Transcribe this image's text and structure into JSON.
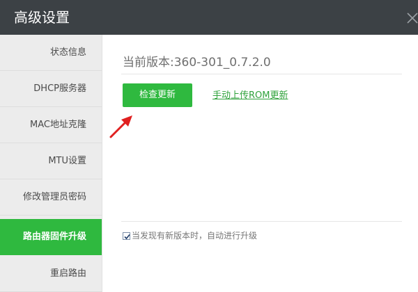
{
  "window": {
    "title": "高级设置",
    "close_icon": "close-icon"
  },
  "colors": {
    "titlebar": "#3c4145",
    "sidebar": "#ececec",
    "accent": "#2fb93f",
    "arrow": "#e02020"
  },
  "sidebar": {
    "items": [
      {
        "label": "状态信息",
        "active": false
      },
      {
        "label": "DHCP服务器",
        "active": false
      },
      {
        "label": "MAC地址克隆",
        "active": false
      },
      {
        "label": "MTU设置",
        "active": false
      },
      {
        "label": "修改管理员密码",
        "active": false
      },
      {
        "label": "路由器固件升级",
        "active": true
      },
      {
        "label": "重启路由",
        "active": false
      }
    ]
  },
  "main": {
    "version_text": "当前版本:360-301_0.7.2.0",
    "check_update_label": "检查更新",
    "manual_upload_label": "手动上传ROM更新",
    "auto_upgrade": {
      "label": "当发现有新版本时，自动进行升级",
      "checked": true
    }
  }
}
